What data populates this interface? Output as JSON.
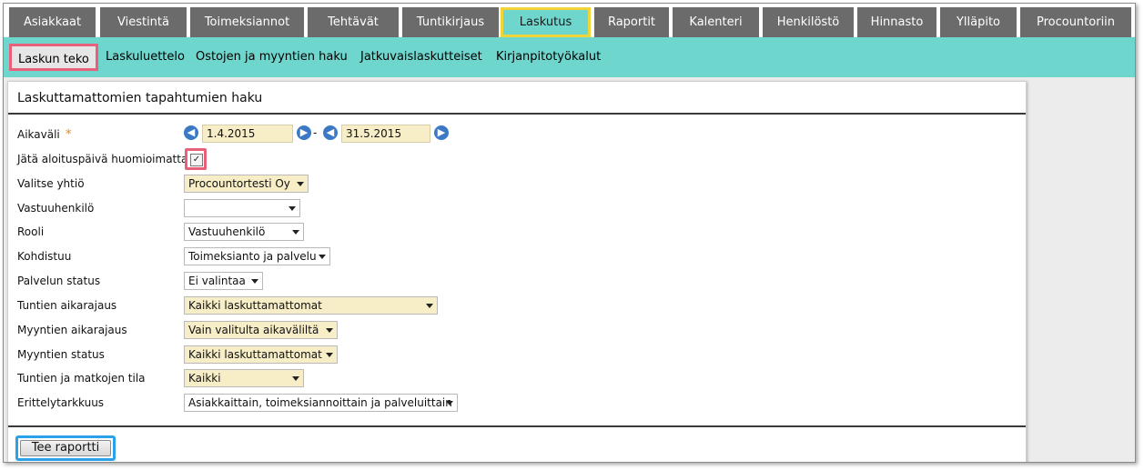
{
  "nav": {
    "tabs": [
      {
        "label": "Asiakkaat"
      },
      {
        "label": "Viestintä"
      },
      {
        "label": "Toimeksiannot"
      },
      {
        "label": "Tehtävät"
      },
      {
        "label": "Tuntikirjaus"
      },
      {
        "label": "Laskutus"
      },
      {
        "label": "Raportit"
      },
      {
        "label": "Kalenteri"
      },
      {
        "label": "Henkilöstö"
      },
      {
        "label": "Hinnasto"
      },
      {
        "label": "Ylläpito"
      },
      {
        "label": "Procountoriin"
      }
    ],
    "active_tab": "Laskutus"
  },
  "subnav": {
    "items": [
      {
        "label": "Laskun teko"
      },
      {
        "label": "Laskuluettelo"
      },
      {
        "label": "Ostojen ja myyntien haku"
      },
      {
        "label": "Jatkuvaislaskutteiset"
      },
      {
        "label": "Kirjanpitotyökalut"
      }
    ],
    "active_item": "Laskun teko"
  },
  "panel": {
    "title": "Laskuttamattomien tapahtumien haku",
    "fields": {
      "aikavali": {
        "label": "Aikaväli",
        "required_mark": "*",
        "from": "1.4.2015",
        "separator": "-",
        "to": "31.5.2015"
      },
      "ignore_start": {
        "label": "Jätä aloituspäivä huomioimatta",
        "checked_mark": "✓"
      },
      "company": {
        "label": "Valitse yhtiö",
        "value": "Procountortesti Oy"
      },
      "responsible": {
        "label": "Vastuuhenkilö",
        "value": ""
      },
      "role": {
        "label": "Rooli",
        "value": "Vastuuhenkilö"
      },
      "target": {
        "label": "Kohdistuu",
        "value": "Toimeksianto ja palvelu"
      },
      "service_status": {
        "label": "Palvelun status",
        "value": "Ei valintaa"
      },
      "hours_range": {
        "label": "Tuntien aikarajaus",
        "value": "Kaikki laskuttamattomat"
      },
      "sales_range": {
        "label": "Myyntien aikarajaus",
        "value": "Vain valitulta aikaväliltä"
      },
      "sales_status": {
        "label": "Myyntien status",
        "value": "Kaikki laskuttamattomat"
      },
      "hours_travel_state": {
        "label": "Tuntien ja matkojen tila",
        "value": "Kaikki"
      },
      "detail_level": {
        "label": "Erittelytarkkuus",
        "value": "Asiakkaittain, toimeksiannoittain ja palveluittain"
      }
    },
    "report_button": "Tee raportti"
  },
  "icons": {
    "prev": "arrow-left-circle-icon",
    "next": "arrow-right-circle-icon"
  },
  "colors": {
    "accent": "#6fd6cd",
    "tab_bg": "#6b6b6b",
    "highlight_pink": "#e8607a",
    "highlight_yellow": "#f0d43a",
    "highlight_blue": "#2aa1e8",
    "input_yellow": "#f7eec8"
  }
}
